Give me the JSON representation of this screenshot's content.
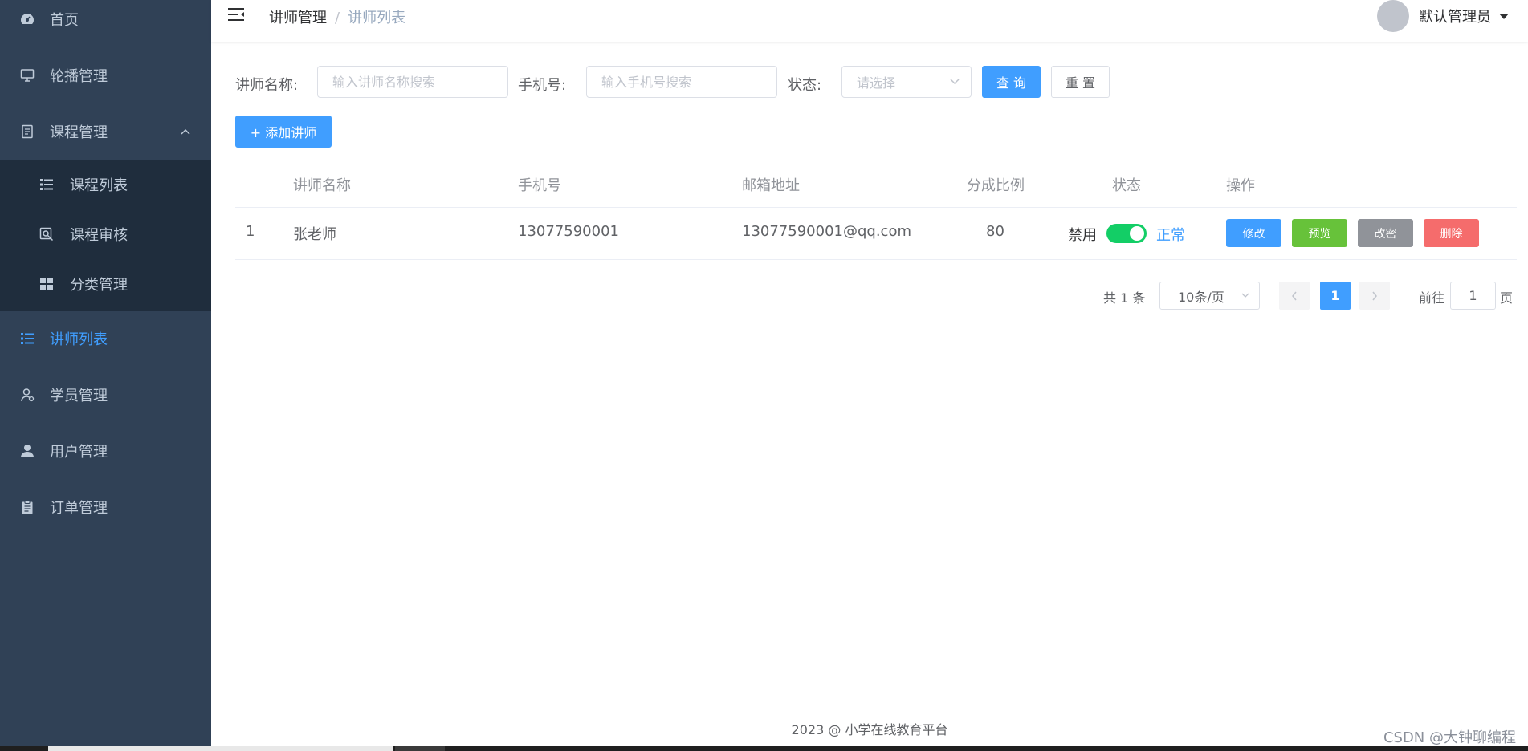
{
  "sidebar": {
    "items": [
      {
        "label": "首页",
        "icon": "dashboard-icon"
      },
      {
        "label": "轮播管理",
        "icon": "monitor-icon"
      },
      {
        "label": "课程管理",
        "icon": "document-icon",
        "expanded": true
      },
      {
        "label": "讲师列表",
        "icon": "list-icon",
        "active": true
      },
      {
        "label": "学员管理",
        "icon": "student-icon"
      },
      {
        "label": "用户管理",
        "icon": "user-icon"
      },
      {
        "label": "订单管理",
        "icon": "clipboard-icon"
      }
    ],
    "sub_items": [
      {
        "label": "课程列表",
        "icon": "list-icon"
      },
      {
        "label": "课程审核",
        "icon": "review-icon"
      },
      {
        "label": "分类管理",
        "icon": "grid-icon"
      }
    ],
    "active_color": "#409eff"
  },
  "navbar": {
    "breadcrumb": {
      "parent": "讲师管理",
      "separator": "/",
      "current": "讲师列表"
    },
    "username": "默认管理员"
  },
  "search": {
    "name_label": "讲师名称:",
    "name_placeholder": "输入讲师名称搜索",
    "phone_label": "手机号:",
    "phone_placeholder": "输入手机号搜索",
    "status_label": "状态:",
    "status_placeholder": "请选择",
    "query_button": "查 询",
    "reset_button": "重 置"
  },
  "add_button": "+ 添加讲师",
  "table": {
    "headers": [
      "讲师名称",
      "手机号",
      "邮箱地址",
      "分成比例",
      "状态",
      "操作"
    ],
    "rows": [
      {
        "index": "1",
        "name": "张老师",
        "phone": "13077590001",
        "email": "13077590001@qq.com",
        "ratio": "80",
        "status_off_text": "禁用",
        "status_on_text": "正常",
        "status_enabled": true
      }
    ],
    "actions": {
      "edit": "修改",
      "preview": "预览",
      "password": "改密",
      "delete": "删除"
    },
    "action_colors": {
      "edit": "#409eff",
      "preview": "#67c23a",
      "password": "#909399",
      "delete": "#f56c6c"
    }
  },
  "pagination": {
    "total_text": "共 1 条",
    "page_size": "10条/页",
    "current_page": "1",
    "goto_label": "前往",
    "goto_value": "1",
    "page_suffix": "页"
  },
  "footer": "2023 @ 小学在线教育平台",
  "watermark": "CSDN @大钟聊编程"
}
